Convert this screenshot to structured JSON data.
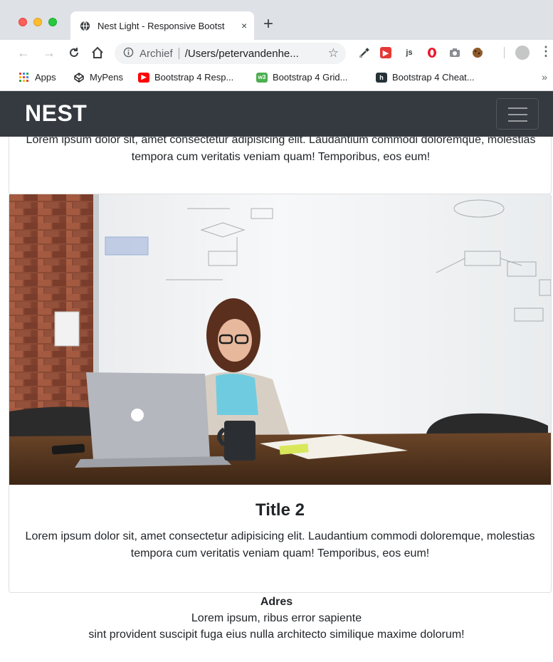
{
  "browser": {
    "tab_title": "Nest Light - Responsive Bootst",
    "close_glyph": "×",
    "new_tab_glyph": "+",
    "omnibox_label": "Archief",
    "url": "/Users/petervandenhe...",
    "extensions": [
      "eyedropper-icon",
      "screencast-icon",
      "js-icon",
      "opera-icon",
      "camera-icon",
      "cookie-icon"
    ]
  },
  "bookmarks": [
    {
      "label": "Apps",
      "icon": "apps-grid-icon"
    },
    {
      "label": "MyPens",
      "icon": "codepen-icon"
    },
    {
      "label": "Bootstrap 4 Resp...",
      "icon": "youtube-icon"
    },
    {
      "label": "Bootstrap 4 Grid...",
      "icon": "w3-icon"
    },
    {
      "label": "Bootstrap 4 Cheat...",
      "icon": "h-icon"
    }
  ],
  "bookmarks_more": "»",
  "navbar": {
    "brand": "NEST"
  },
  "card1": {
    "text": "Lorem ipsum dolor sit, amet consectetur adipisicing elit. Laudantium commodi doloremque, molestias tempora cum veritatis veniam quam! Temporibus, eos eum!"
  },
  "card2": {
    "title": "Title 2",
    "text": "Lorem ipsum dolor sit, amet consectetur adipisicing elit. Laudantium commodi doloremque, molestias tempora cum veritatis veniam quam! Temporibus, eos eum!"
  },
  "footer": {
    "heading": "Adres",
    "line1": "Lorem ipsum, ribus error sapiente",
    "line2": "sint provident suscipit fuga eius nulla architecto similique maxime dolorum!"
  },
  "colors": {
    "navbar_bg": "#343a40",
    "text": "#212529"
  }
}
